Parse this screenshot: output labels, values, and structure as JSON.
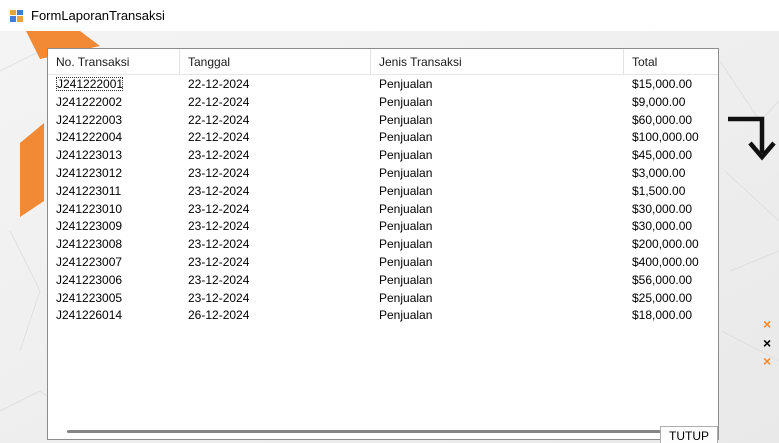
{
  "window": {
    "title": "FormLaporanTransaksi"
  },
  "listview": {
    "columns": [
      "No. Transaksi",
      "Tanggal",
      "Jenis Transaksi",
      "Total"
    ],
    "rows": [
      [
        "J241222001",
        "22-12-2024",
        "Penjualan",
        "$15,000.00"
      ],
      [
        "J241222002",
        "22-12-2024",
        "Penjualan",
        "$9,000.00"
      ],
      [
        "J241222003",
        "22-12-2024",
        "Penjualan",
        "$60,000.00"
      ],
      [
        "J241222004",
        "22-12-2024",
        "Penjualan",
        "$100,000.00"
      ],
      [
        "J241223013",
        "23-12-2024",
        "Penjualan",
        "$45,000.00"
      ],
      [
        "J241223012",
        "23-12-2024",
        "Penjualan",
        "$3,000.00"
      ],
      [
        "J241223011",
        "23-12-2024",
        "Penjualan",
        "$1,500.00"
      ],
      [
        "J241223010",
        "23-12-2024",
        "Penjualan",
        "$30,000.00"
      ],
      [
        "J241223009",
        "23-12-2024",
        "Penjualan",
        "$30,000.00"
      ],
      [
        "J241223008",
        "23-12-2024",
        "Penjualan",
        "$200,000.00"
      ],
      [
        "J241223007",
        "23-12-2024",
        "Penjualan",
        "$400,000.00"
      ],
      [
        "J241223006",
        "23-12-2024",
        "Penjualan",
        "$56,000.00"
      ],
      [
        "J241223005",
        "23-12-2024",
        "Penjualan",
        "$25,000.00"
      ],
      [
        "J241226014",
        "26-12-2024",
        "Penjualan",
        "$18,000.00"
      ]
    ]
  },
  "buttons": {
    "close_label": "TUTUP"
  },
  "decorations": {
    "x_marks": [
      "×",
      "×",
      "×"
    ]
  },
  "colors": {
    "accent_orange": "#f08a3c",
    "selection_border": "#333333"
  }
}
